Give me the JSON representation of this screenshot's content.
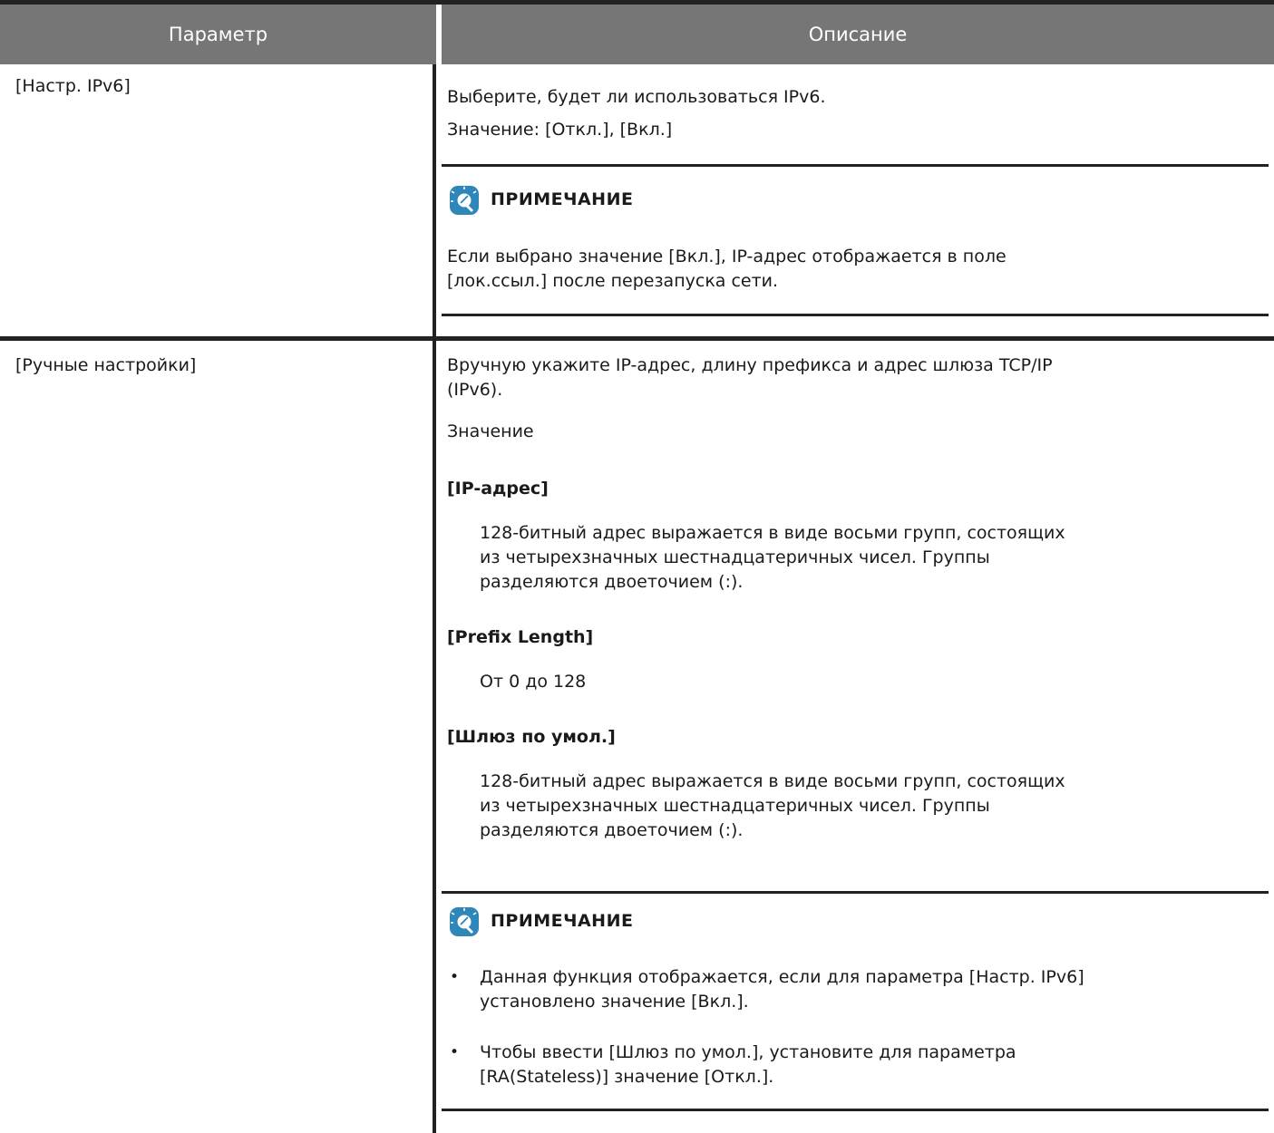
{
  "table": {
    "header": {
      "param": "Параметр",
      "desc": "Описание"
    },
    "rows": [
      {
        "param": "[Настр. IPv6]",
        "desc_lines": [
          "Выберите, будет ли использоваться IPv6.",
          "Значение: [Откл.], [Вкл.]"
        ],
        "note": {
          "title": "ПРИМЕЧАНИЕ",
          "icon": "note-lightbulb-icon",
          "lines": [
            "Если выбрано значение [Вкл.], IP-адрес отображается в поле",
            "[лок.ссыл.] после перезапуска сети."
          ]
        }
      },
      {
        "param": "[Ручные настройки]",
        "desc_lines": [
          "Вручную укажите IP-адрес, длину префикса и адрес шлюза TCP/IP",
          "(IPv6).",
          "Значение"
        ],
        "values": [
          {
            "title": "[IP-адрес]",
            "lines": [
              "128-битный адрес выражается в виде восьми групп, состоящих",
              "из четырехзначных шестнадцатеричных чисел. Группы",
              "разделяются двоеточием (:)."
            ]
          },
          {
            "title": "[Prefix Length]",
            "lines": [
              "От 0 до 128"
            ]
          },
          {
            "title": "[Шлюз по умол.]",
            "lines": [
              "128-битный адрес выражается в виде восьми групп, состоящих",
              "из четырехзначных шестнадцатеричных чисел. Группы",
              "разделяются двоеточием (:)."
            ]
          }
        ],
        "note": {
          "title": "ПРИМЕЧАНИЕ",
          "icon": "note-lightbulb-icon",
          "bullet": "•",
          "items": [
            [
              "Данная функция отображается, если для параметра [Настр. IPv6]",
              "установлено значение [Вкл.]."
            ],
            [
              "Чтобы ввести [Шлюз по умол.], установите для параметра",
              "[RA(Stateless)] значение [Откл.]."
            ]
          ]
        }
      }
    ]
  },
  "colors": {
    "header_bg": "#767676",
    "rule": "#222222",
    "icon_blue": "#2f86b8"
  }
}
